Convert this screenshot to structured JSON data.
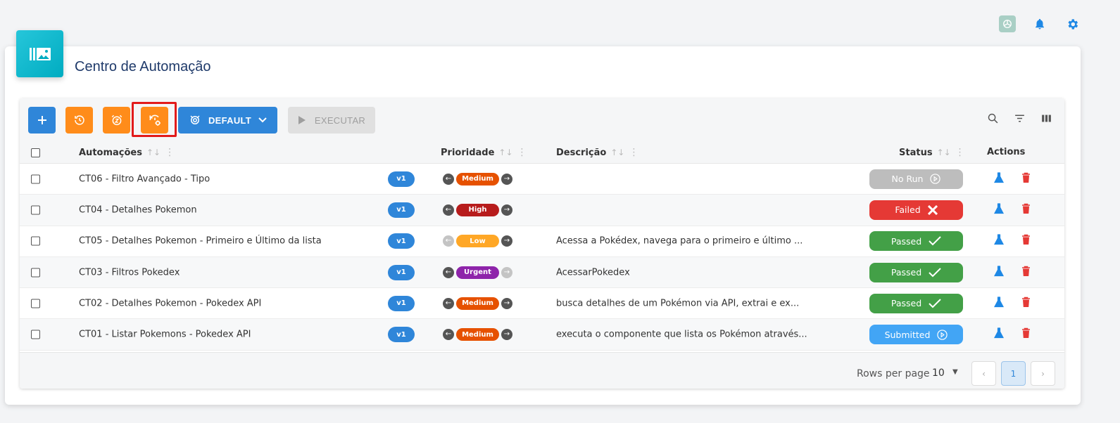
{
  "page": {
    "title": "Centro de Automação"
  },
  "topbar": {
    "icons": [
      "chatgpt-icon",
      "bell-icon",
      "gear-icon"
    ]
  },
  "toolbar": {
    "add_icon": "plus-icon",
    "history_icon": "history-icon",
    "snooze_icon": "alarm-snooze-icon",
    "history_settings_icon": "history-settings-icon",
    "environment_label": "DEFAULT",
    "execute_label": "EXECUTAR",
    "right_tools": [
      "search-icon",
      "filter-icon",
      "columns-icon"
    ]
  },
  "table": {
    "headers": {
      "automacoes": "Automações",
      "prioridade": "Prioridade",
      "descricao": "Descrição",
      "status": "Status",
      "actions": "Actions"
    },
    "rows": [
      {
        "name": "CT06 - Filtro Avançado - Tipo",
        "version": "v1",
        "priority": "Medium",
        "priority_color": "#e65100",
        "left_arrow_dim": false,
        "right_arrow_dim": false,
        "description": "",
        "status": "No Run",
        "status_color": "#bdbdbd",
        "status_icon": "play-circle-icon"
      },
      {
        "name": "CT04 - Detalhes Pokemon",
        "version": "v1",
        "priority": "High",
        "priority_color": "#b71c1c",
        "left_arrow_dim": false,
        "right_arrow_dim": false,
        "description": "",
        "status": "Failed",
        "status_color": "#e53935",
        "status_icon": "x-icon"
      },
      {
        "name": "CT05 - Detalhes Pokemon - Primeiro e Último da lista",
        "version": "v1",
        "priority": "Low",
        "priority_color": "#ffa726",
        "left_arrow_dim": true,
        "right_arrow_dim": false,
        "description": "Acessa a Pokédex, navega para o primeiro e último ...",
        "status": "Passed",
        "status_color": "#43a047",
        "status_icon": "check-icon"
      },
      {
        "name": "CT03 - Filtros Pokedex",
        "version": "v1",
        "priority": "Urgent",
        "priority_color": "#8e24aa",
        "left_arrow_dim": false,
        "right_arrow_dim": true,
        "description": "AcessarPokedex",
        "status": "Passed",
        "status_color": "#43a047",
        "status_icon": "check-icon"
      },
      {
        "name": "CT02 - Detalhes Pokemon - Pokedex API",
        "version": "v1",
        "priority": "Medium",
        "priority_color": "#e65100",
        "left_arrow_dim": false,
        "right_arrow_dim": false,
        "description": "busca detalhes de um Pokémon via API, extrai e ex...",
        "status": "Passed",
        "status_color": "#43a047",
        "status_icon": "check-icon"
      },
      {
        "name": "CT01 - Listar Pokemons - Pokedex API",
        "version": "v1",
        "priority": "Medium",
        "priority_color": "#e65100",
        "left_arrow_dim": false,
        "right_arrow_dim": false,
        "description": "executa o componente que lista os Pokémon através...",
        "status": "Submitted",
        "status_color": "#42a5f5",
        "status_icon": "play-circle-icon"
      }
    ]
  },
  "pagination": {
    "rows_per_page_label": "Rows per page",
    "rows_per_page": "10",
    "current_page": "1"
  }
}
